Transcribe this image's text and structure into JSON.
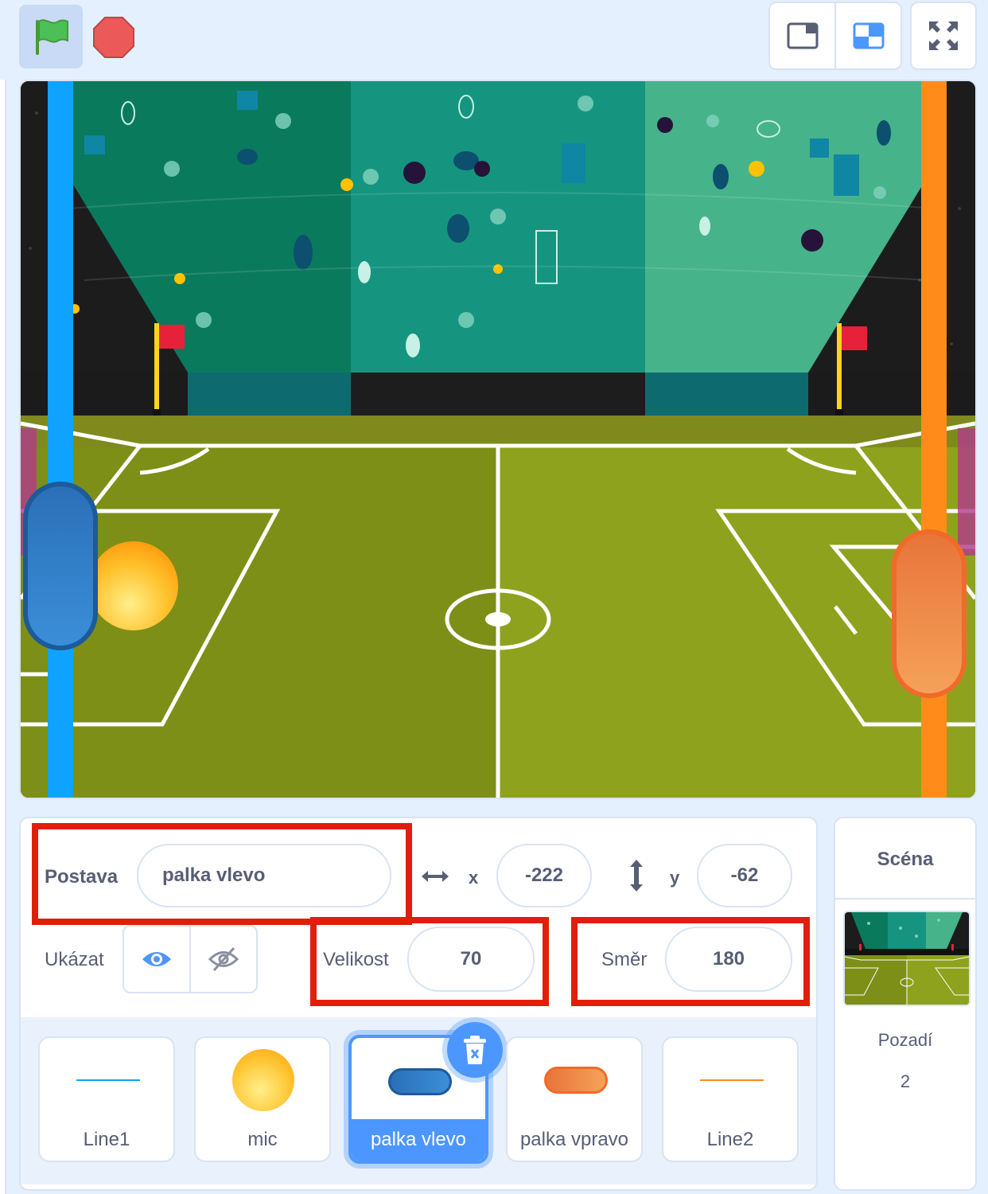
{
  "sprite_info": {
    "sprite_label": "Postava",
    "sprite_name": "palka vlevo",
    "x_label": "x",
    "x_value": "-222",
    "y_label": "y",
    "y_value": "-62",
    "show_label": "Ukázat",
    "size_label": "Velikost",
    "size_value": "70",
    "direction_label": "Směr",
    "direction_value": "180",
    "highlight_color": "#e01e0b"
  },
  "sprites": [
    {
      "name": "Line1"
    },
    {
      "name": "mic"
    },
    {
      "name": "palka vlevo",
      "selected": true
    },
    {
      "name": "palka vpravo"
    },
    {
      "name": "Line2"
    }
  ],
  "scene": {
    "title": "Scéna",
    "backdrops_label": "Pozadí",
    "backdrops_count": "2"
  },
  "icons": {
    "green_flag": "green-flag-icon",
    "stop": "stop-icon",
    "small_stage": "small-stage-icon",
    "normal_stage": "normal-stage-icon",
    "fullscreen": "fullscreen-icon",
    "trash": "trash-icon",
    "show": "eye-icon",
    "hide": "eye-slash-icon"
  },
  "colors": {
    "accent": "#4c97ff",
    "left_line": "#0fa3ff",
    "right_line": "#ff8c1a"
  }
}
